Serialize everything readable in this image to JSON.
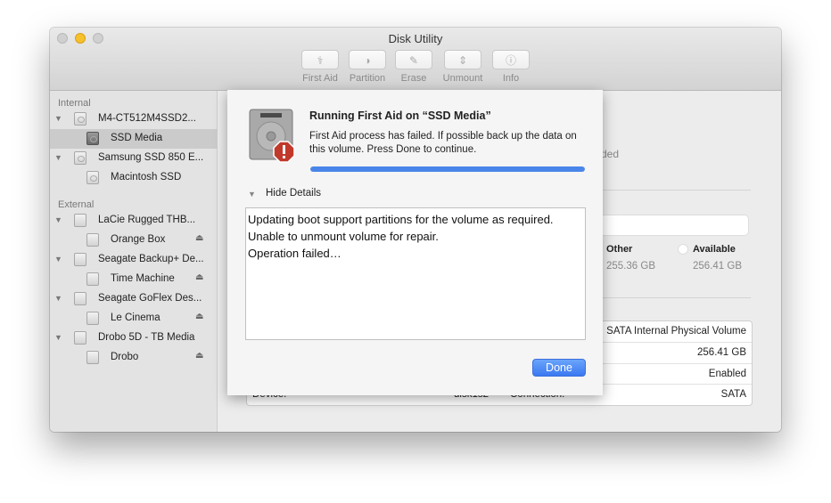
{
  "window": {
    "title": "Disk Utility"
  },
  "toolbar": {
    "buttons": [
      {
        "label": "First Aid",
        "icon": "stethoscope-icon",
        "glyph": "⚕"
      },
      {
        "label": "Partition",
        "icon": "pie-chart-icon",
        "glyph": "◑"
      },
      {
        "label": "Erase",
        "icon": "erase-icon",
        "glyph": "✎"
      },
      {
        "label": "Unmount",
        "icon": "unmount-icon",
        "glyph": "⇕"
      },
      {
        "label": "Info",
        "icon": "info-icon",
        "glyph": "ⓘ"
      }
    ]
  },
  "sidebar": {
    "internal_label": "Internal",
    "external_label": "External",
    "items": [
      {
        "label": "M4-CT512M4SSD2...",
        "level": 0,
        "section": "internal"
      },
      {
        "label": "SSD Media",
        "level": 1,
        "section": "internal",
        "selected": true
      },
      {
        "label": "Samsung SSD 850 E...",
        "level": 0,
        "section": "internal"
      },
      {
        "label": "Macintosh SSD",
        "level": 1,
        "section": "internal"
      },
      {
        "label": "LaCie Rugged THB...",
        "level": 0,
        "section": "external"
      },
      {
        "label": "Orange Box",
        "level": 1,
        "section": "external",
        "eject": true
      },
      {
        "label": "Seagate Backup+ De...",
        "level": 0,
        "section": "external"
      },
      {
        "label": "Time Machine",
        "level": 1,
        "section": "external",
        "eject": true
      },
      {
        "label": "Seagate GoFlex Des...",
        "level": 0,
        "section": "external"
      },
      {
        "label": "Le Cinema",
        "level": 1,
        "section": "external",
        "eject": true
      },
      {
        "label": "Drobo 5D - TB Media",
        "level": 0,
        "section": "external"
      },
      {
        "label": "Drobo",
        "level": 1,
        "section": "external",
        "eject": true
      }
    ],
    "eject_glyph": "⏏",
    "disclosure_glyph": "▼"
  },
  "content": {
    "partial_status": "ded",
    "usage": {
      "other_label": "Other",
      "other_value": "255.36 GB",
      "available_label": "Available",
      "available_value": "256.41 GB"
    },
    "info_rows": [
      {
        "value": "SATA Internal Physical Volume"
      },
      {
        "value": "256.41 GB"
      },
      {
        "value": "Enabled"
      },
      {
        "key": "Device:",
        "mid": "disk1s2",
        "mkey": "Connection:",
        "value": "SATA"
      }
    ]
  },
  "sheet": {
    "title": "Running First Aid on “SSD Media”",
    "message": "First Aid process has failed. If possible back up the data on this volume. Press Done to continue.",
    "progress": 1.0,
    "details_toggle": "Hide Details",
    "log_lines": [
      "Updating boot support partitions for the volume as required.",
      "Unable to unmount volume for repair.",
      "Operation failed…"
    ],
    "done_label": "Done",
    "accent_color": "#4a86ea",
    "alert_color": "#c0392b"
  }
}
